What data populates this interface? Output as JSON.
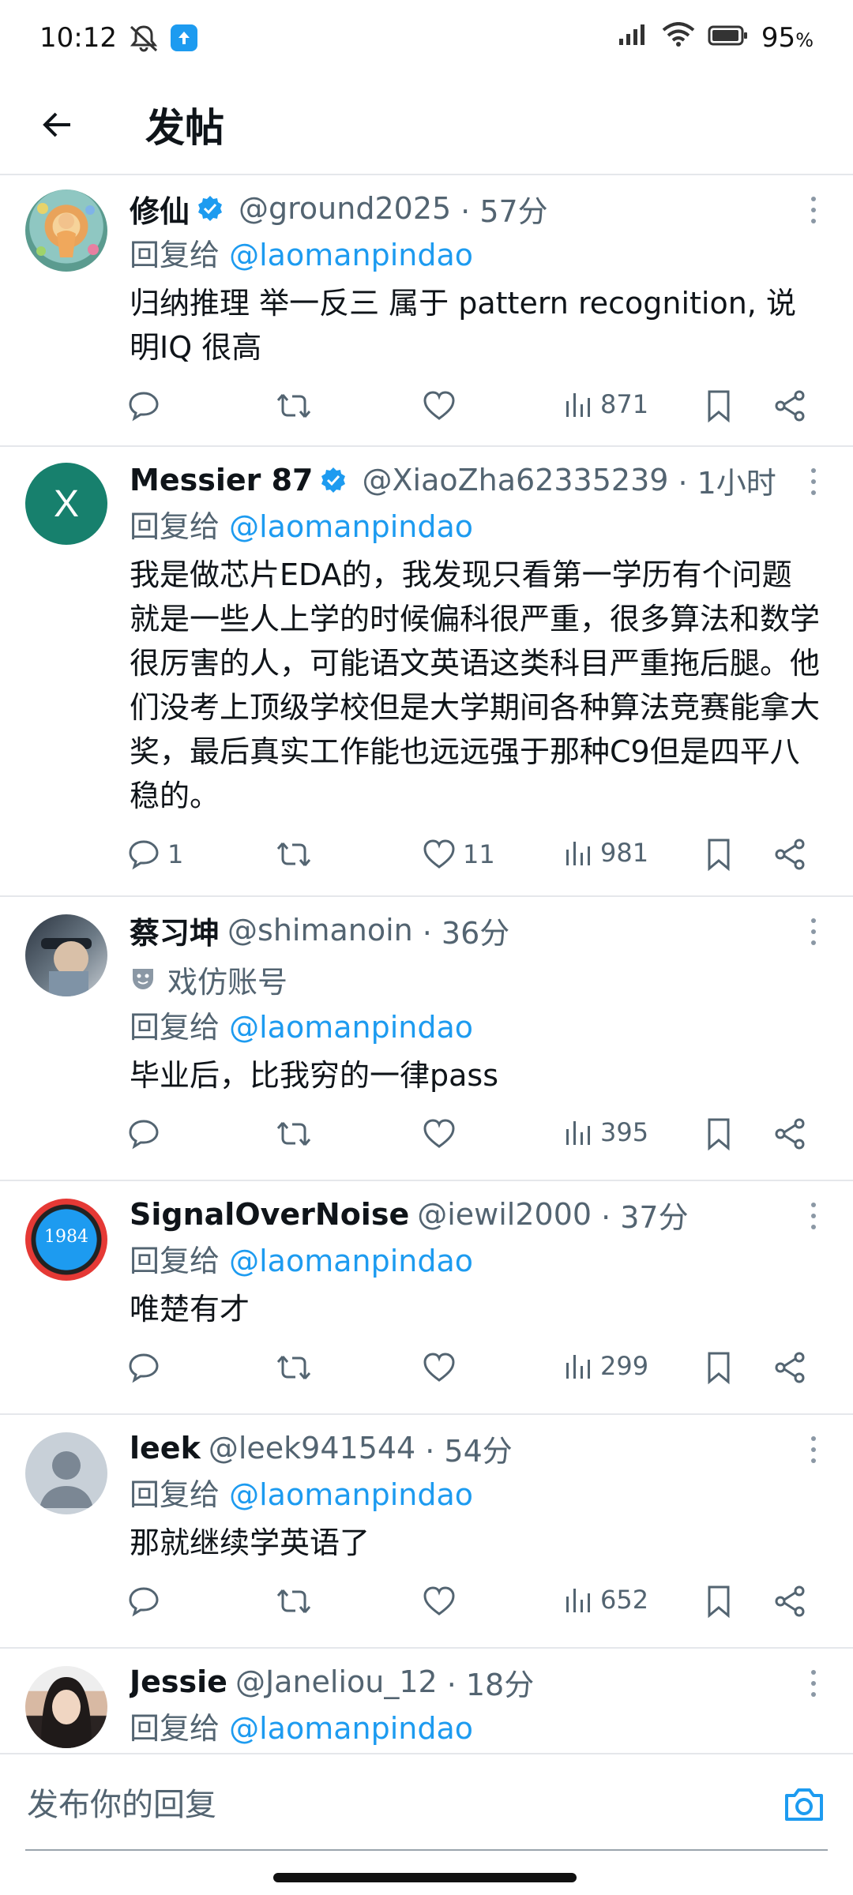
{
  "status_bar": {
    "time": "10:12",
    "battery": "95",
    "battery_unit": "%"
  },
  "header": {
    "title": "发帖"
  },
  "reply_prefix": "回复给",
  "posts": [
    {
      "name": "修仙",
      "verified": true,
      "handle": "@ground2025",
      "time": "· 57分",
      "reply_to": "@laomanpindao",
      "text": "归纳推理 举一反三 属于 pattern recognition, 说明IQ 很高",
      "replies": "",
      "likes": "",
      "views": "871"
    },
    {
      "name": "Messier 87",
      "verified": true,
      "handle": "@XiaoZha62335239",
      "time": "· 1小时",
      "reply_to": "@laomanpindao",
      "avatar_letter": "X",
      "text": "我是做芯片EDA的，我发现只看第一学历有个问题就是一些人上学的时候偏科很严重，很多算法和数学很厉害的人，可能语文英语这类科目严重拖后腿。他们没考上顶级学校但是大学期间各种算法竞赛能拿大奖，最后真实工作能也远远强于那种C9但是四平八稳的。",
      "replies": "1",
      "likes": "11",
      "views": "981"
    },
    {
      "name": "蔡习坤",
      "verified": false,
      "handle": "@shimanoin",
      "time": "· 36分",
      "parody_label": "戏仿账号",
      "reply_to": "@laomanpindao",
      "text": "毕业后，比我穷的一律pass",
      "replies": "",
      "likes": "",
      "views": "395"
    },
    {
      "name": "SignalOverNoise",
      "verified": false,
      "handle": "@iewil2000",
      "time": "· 37分",
      "reply_to": "@laomanpindao",
      "avatar_text": "1984",
      "text": "唯楚有才",
      "replies": "",
      "likes": "",
      "views": "299"
    },
    {
      "name": "leek",
      "verified": false,
      "handle": "@leek941544",
      "time": "· 54分",
      "reply_to": "@laomanpindao",
      "text": "那就继续学英语了",
      "replies": "",
      "likes": "",
      "views": "652"
    },
    {
      "name": "Jessie",
      "verified": false,
      "handle": "@Janeliou_12",
      "time": "· 18分",
      "reply_to": "@laomanpindao"
    }
  ],
  "composer": {
    "placeholder": "发布你的回复"
  },
  "colors": {
    "accent": "#1d9bf0",
    "text": "#0f1419",
    "muted": "#536471",
    "divider": "#e5e7eb"
  }
}
